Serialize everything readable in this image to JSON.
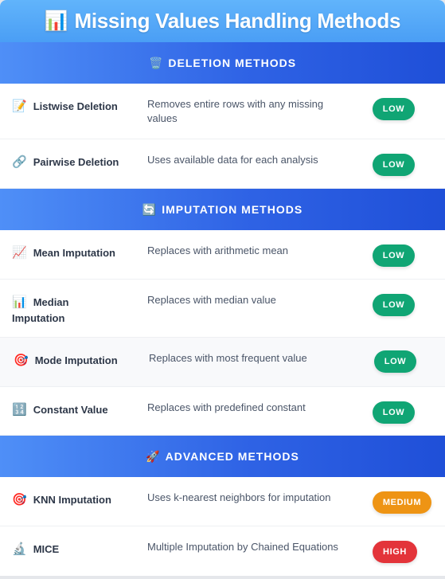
{
  "title": {
    "emoji": "📊",
    "text": "Missing Values Handling Methods"
  },
  "sections": [
    {
      "emoji": "🗑️",
      "title": "DELETION METHODS",
      "rows": [
        {
          "emoji": "📝",
          "name": "Listwise Deletion",
          "description": "Removes entire rows with any missing values",
          "badge": "LOW",
          "level": "low"
        },
        {
          "emoji": "🔗",
          "name": "Pairwise Deletion",
          "description": "Uses available data for each analysis",
          "badge": "LOW",
          "level": "low"
        }
      ]
    },
    {
      "emoji": "🔄",
      "title": "IMPUTATION METHODS",
      "rows": [
        {
          "emoji": "📈",
          "name": "Mean Imputation",
          "description": "Replaces with arithmetic mean",
          "badge": "LOW",
          "level": "low"
        },
        {
          "emoji": "📊",
          "name": "Median Imputation",
          "description": "Replaces with median value",
          "badge": "LOW",
          "level": "low"
        },
        {
          "emoji": "🎯",
          "name": "Mode Imputation",
          "description": "Replaces with most frequent value",
          "badge": "LOW",
          "level": "low"
        },
        {
          "emoji": "🔢",
          "name": "Constant Value",
          "description": "Replaces with predefined constant",
          "badge": "LOW",
          "level": "low"
        }
      ]
    },
    {
      "emoji": "🚀",
      "title": "ADVANCED METHODS",
      "rows": [
        {
          "emoji": "🎯",
          "name": "KNN Imputation",
          "description": "Uses k-nearest neighbors for imputation",
          "badge": "MEDIUM",
          "level": "medium"
        },
        {
          "emoji": "🔬",
          "name": "MICE",
          "description": "Multiple Imputation by Chained Equations",
          "badge": "HIGH",
          "level": "high"
        }
      ]
    }
  ],
  "colors": {
    "low": "#10a574",
    "medium": "#ee9414",
    "high": "#e3343a",
    "section": "#2f63e5",
    "title": "#4a9ef5"
  }
}
